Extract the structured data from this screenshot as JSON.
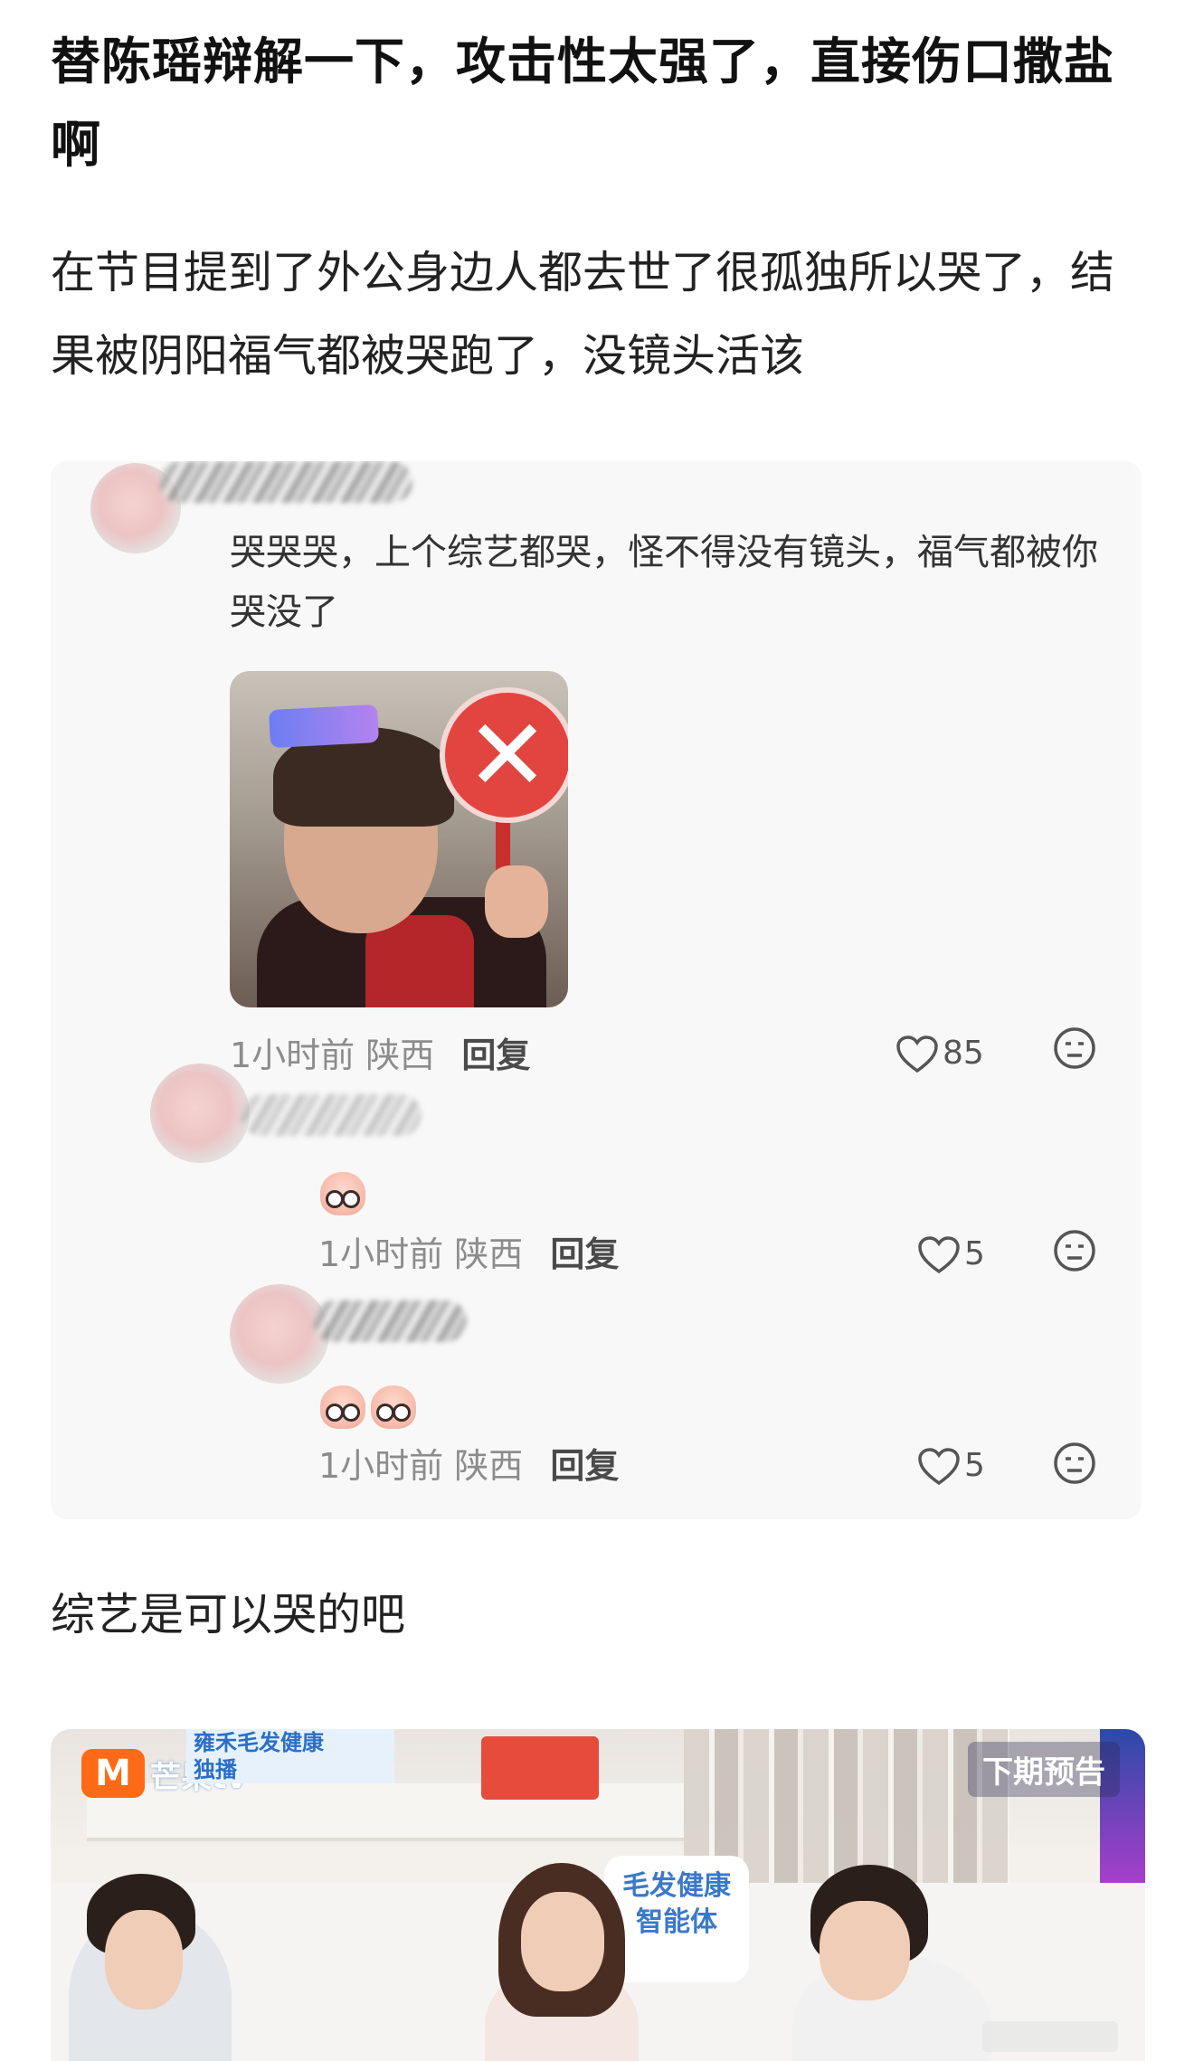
{
  "post": {
    "title": "替陈瑶辩解一下，攻击性太强了，直接伤口撒盐啊",
    "paragraph_1": "在节目提到了外公身边人都去世了很孤独所以哭了，结果被阴阳福气都被哭跑了，没镜头活该",
    "paragraph_2": "综艺是可以哭的吧"
  },
  "comments": [
    {
      "text": "哭哭哭，上个综艺都哭，怪不得没有镜头，福气都被你哭没了",
      "image_icon": "reject-x-sign-meme",
      "time": "1小时前",
      "location": "陕西",
      "reply_label": "回复",
      "likes": "85"
    },
    {
      "text": "",
      "stickers": 1,
      "time": "1小时前",
      "location": "陕西",
      "reply_label": "回复",
      "likes": "5"
    },
    {
      "text": "",
      "stickers": 2,
      "time": "1小时前",
      "location": "陕西",
      "reply_label": "回复",
      "likes": "5"
    }
  ],
  "video": {
    "logo_text": "芒果tv",
    "logo_sub": "独播",
    "brand_banner": "雍禾毛发健康",
    "next_label": "下期预告",
    "pillow_text": "毛发健康",
    "pillow_sub": "智能体"
  },
  "colors": {
    "card_bg": "#f8f8f8",
    "meta_gray": "#8c8c8c",
    "accent_orange": "#ff6a16"
  }
}
